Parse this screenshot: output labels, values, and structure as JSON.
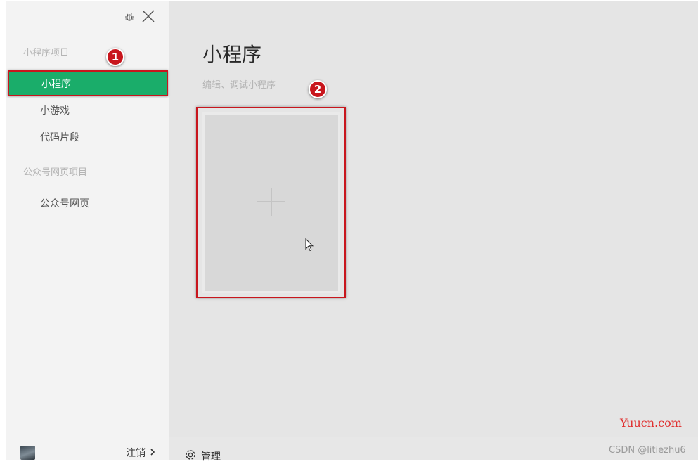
{
  "sidebar": {
    "groups": [
      {
        "label": "小程序项目",
        "items": [
          {
            "label": "小程序",
            "active": true
          },
          {
            "label": "小游戏",
            "active": false
          },
          {
            "label": "代码片段",
            "active": false
          }
        ]
      },
      {
        "label": "公众号网页项目",
        "items": [
          {
            "label": "公众号网页",
            "active": false
          }
        ]
      }
    ],
    "top_icons": [
      "bug-icon",
      "close-icon"
    ],
    "footer": {
      "logout_label": "注销",
      "logout_icon": "chevron-right-icon"
    }
  },
  "main": {
    "title": "小程序",
    "subtitle": "编辑、调试小程序",
    "new_project_icon": "plus-icon"
  },
  "footer": {
    "manage_label": "管理",
    "manage_icon": "gear-icon"
  },
  "annotations": {
    "badges": [
      "1",
      "2"
    ],
    "highlight_color": "#c8161d"
  },
  "watermarks": {
    "site": "Yuucn.com",
    "author": "CSDN @litiezhu6"
  },
  "colors": {
    "accent": "#1aad6a",
    "sidebar_bg": "#f3f3f3",
    "main_bg": "#e5e5e5"
  }
}
